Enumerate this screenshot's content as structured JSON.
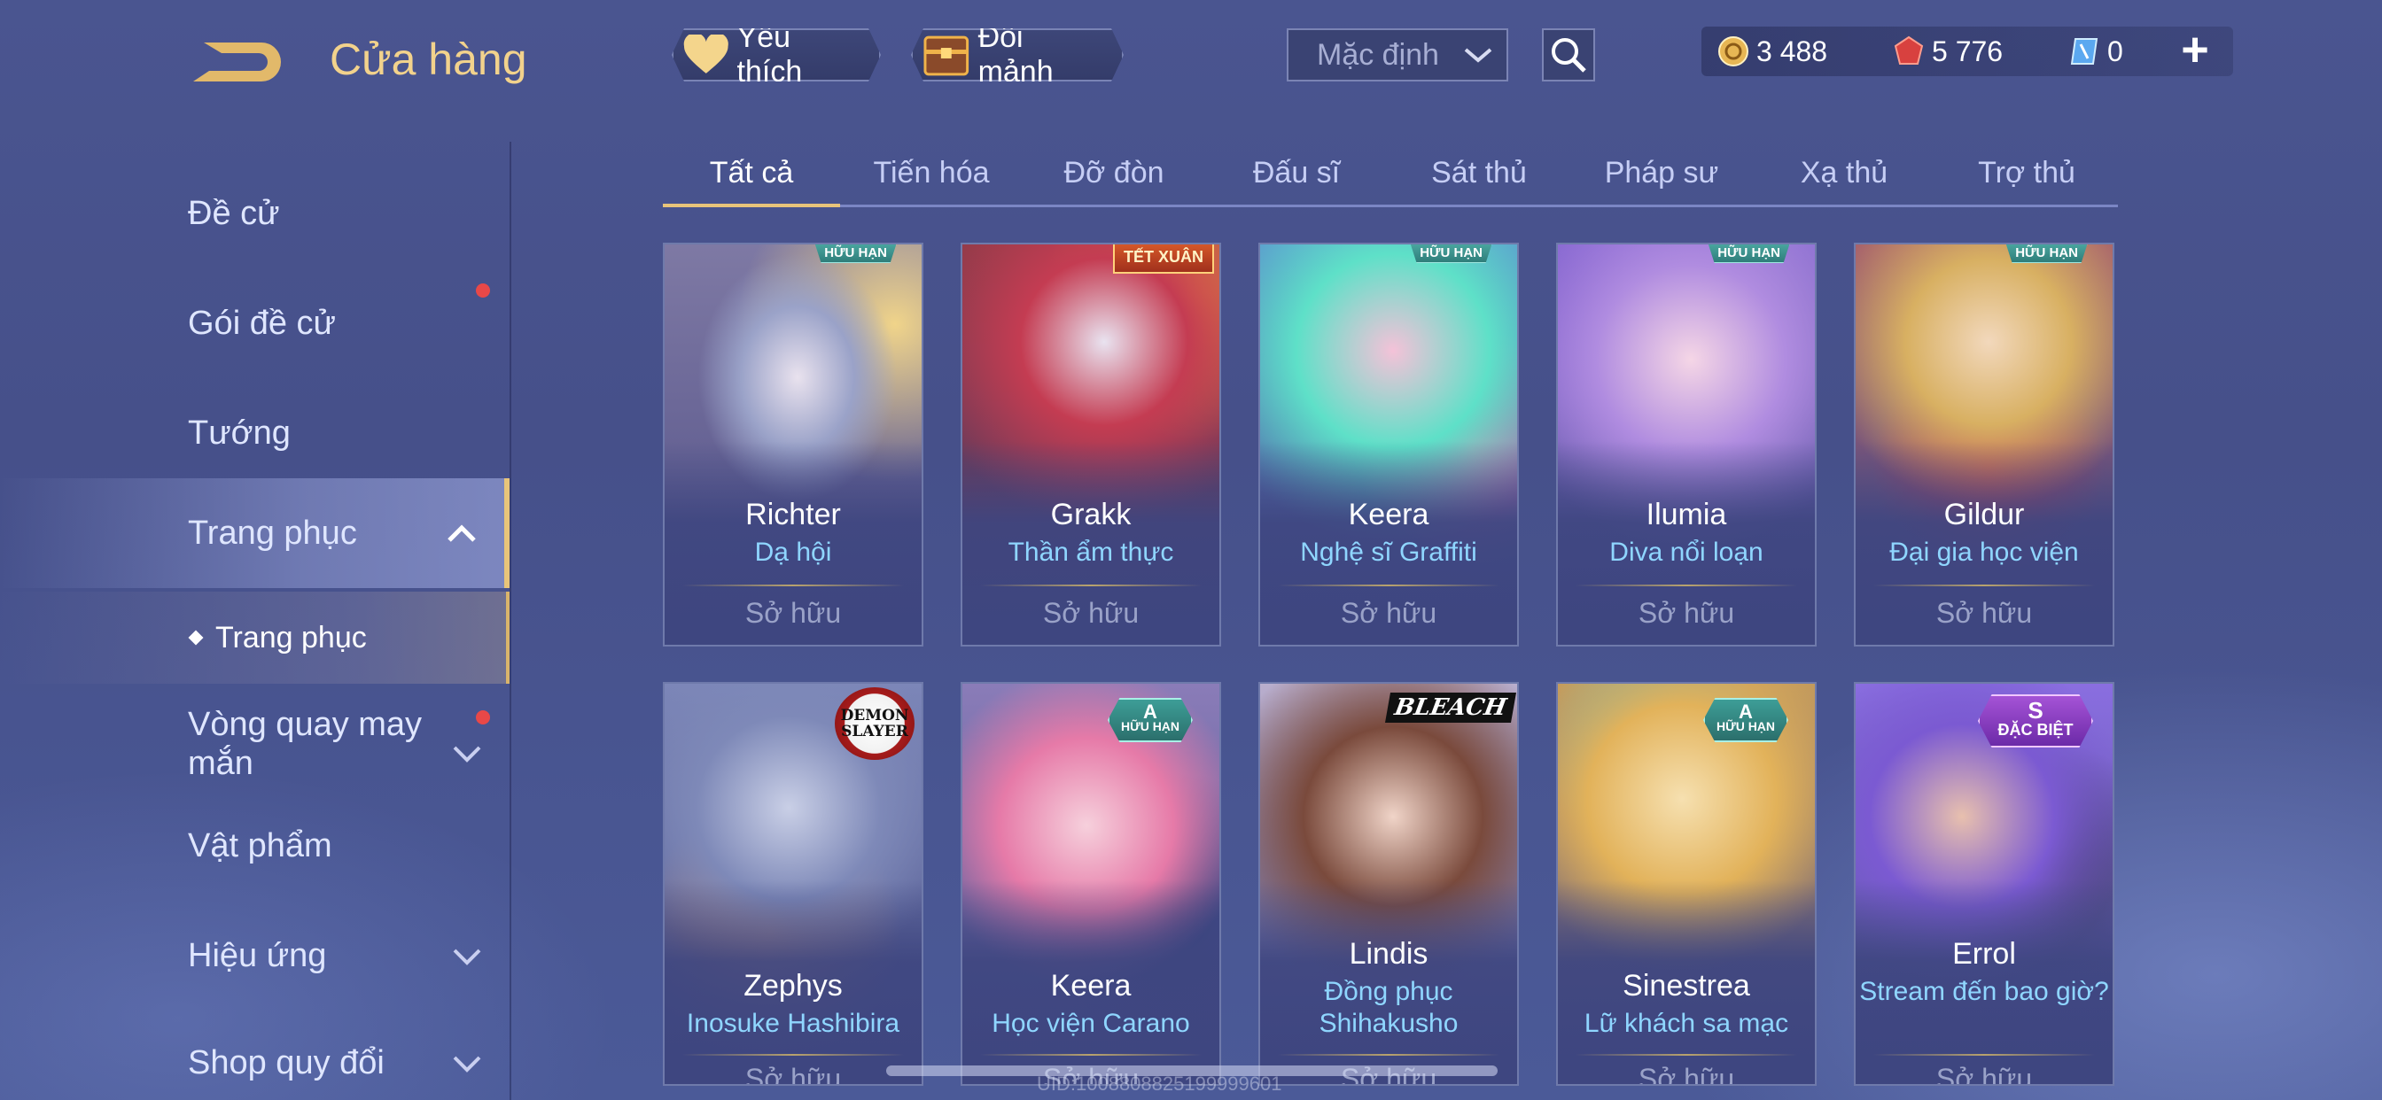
{
  "header": {
    "title": "Cửa hàng",
    "favorites_label": "Yêu thích",
    "exchange_label": "Đổi mảnh",
    "sort_value": "Mặc định",
    "currencies": [
      {
        "icon": "gold-coin-icon",
        "value": "3 488"
      },
      {
        "icon": "ruby-gem-icon",
        "value": "5 776"
      },
      {
        "icon": "voucher-icon",
        "value": "0"
      }
    ],
    "plus_label": "+"
  },
  "sidebar": {
    "items": [
      {
        "label": "Đề cử"
      },
      {
        "label": "Gói đề cử"
      },
      {
        "label": "Tướng"
      },
      {
        "label": "Trang phục"
      },
      {
        "label": "Trang phục"
      },
      {
        "label": "Vòng quay may mắn"
      },
      {
        "label": "Vật phẩm"
      },
      {
        "label": "Hiệu ứng"
      },
      {
        "label": "Shop quy đổi"
      }
    ]
  },
  "tabs": [
    "Tất cả",
    "Tiến hóa",
    "Đỡ đòn",
    "Đấu sĩ",
    "Sát thủ",
    "Pháp sư",
    "Xạ thủ",
    "Trợ thủ"
  ],
  "cards": [
    {
      "hero": "Richter",
      "skin": "Dạ hội",
      "status": "Sở hữu",
      "badge": "HỮU HẠN"
    },
    {
      "hero": "Grakk",
      "skin": "Thần ẩm thực",
      "status": "Sở hữu",
      "badge": "TẾT XUÂN"
    },
    {
      "hero": "Keera",
      "skin": "Nghệ sĩ Graffiti",
      "status": "Sở hữu",
      "badge": "HỮU HẠN"
    },
    {
      "hero": "Ilumia",
      "skin": "Diva nổi loạn",
      "status": "Sở hữu",
      "badge": "HỮU HẠN"
    },
    {
      "hero": "Gildur",
      "skin": "Đại gia học viện",
      "status": "Sở hữu",
      "badge": "HỮU HẠN"
    },
    {
      "hero": "Zephys",
      "skin": "Inosuke Hashibira",
      "status": "Sở hữu",
      "badge": "DEMON SLAYER"
    },
    {
      "hero": "Keera",
      "skin": "Học viện Carano",
      "status": "Sở hữu",
      "badge_tier": "A",
      "badge": "HỮU HẠN"
    },
    {
      "hero": "Lindis",
      "skin": "Đồng phục Shihakusho",
      "status": "Sở hữu",
      "badge": "BLEACH"
    },
    {
      "hero": "Sinestrea",
      "skin": "Lữ khách sa mạc",
      "status": "Sở hữu",
      "badge_tier": "A",
      "badge": "HỮU HẠN"
    },
    {
      "hero": "Errol",
      "skin": "Stream đến bao giờ?",
      "status": "Sở hữu",
      "badge_tier": "S",
      "badge": "ĐẶC BIỆT"
    }
  ],
  "watermark": "UID:1008808825199999601",
  "colors": {
    "accent_gold": "#e8c47a",
    "skin_name_blue": "#8fd6ff",
    "notification_red": "#e84848"
  }
}
